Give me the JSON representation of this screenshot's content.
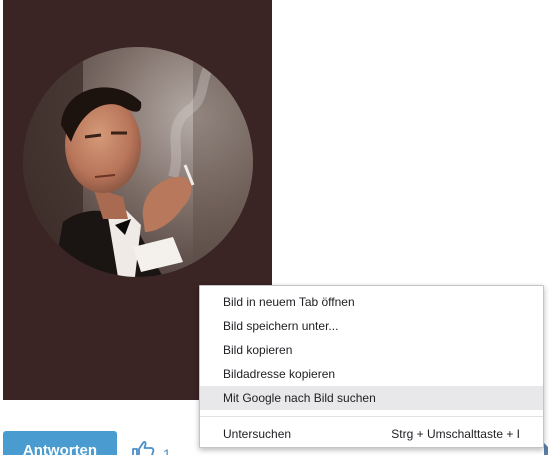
{
  "image": {
    "background_color": "#3a2424",
    "description_icon": "portrait-photo"
  },
  "footer": {
    "reply_label": "Antworten",
    "like_count": "1"
  },
  "context_menu": {
    "items": [
      {
        "label": "Bild in neuem Tab öffnen"
      },
      {
        "label": "Bild speichern unter..."
      },
      {
        "label": "Bild kopieren"
      },
      {
        "label": "Bildadresse kopieren"
      },
      {
        "label": "Mit Google nach Bild suchen"
      }
    ],
    "inspect": {
      "label": "Untersuchen",
      "shortcut": "Strg + Umschalttaste + I"
    }
  },
  "colors": {
    "accent": "#4a9bd0",
    "menu_highlight": "#e8e8ea"
  }
}
